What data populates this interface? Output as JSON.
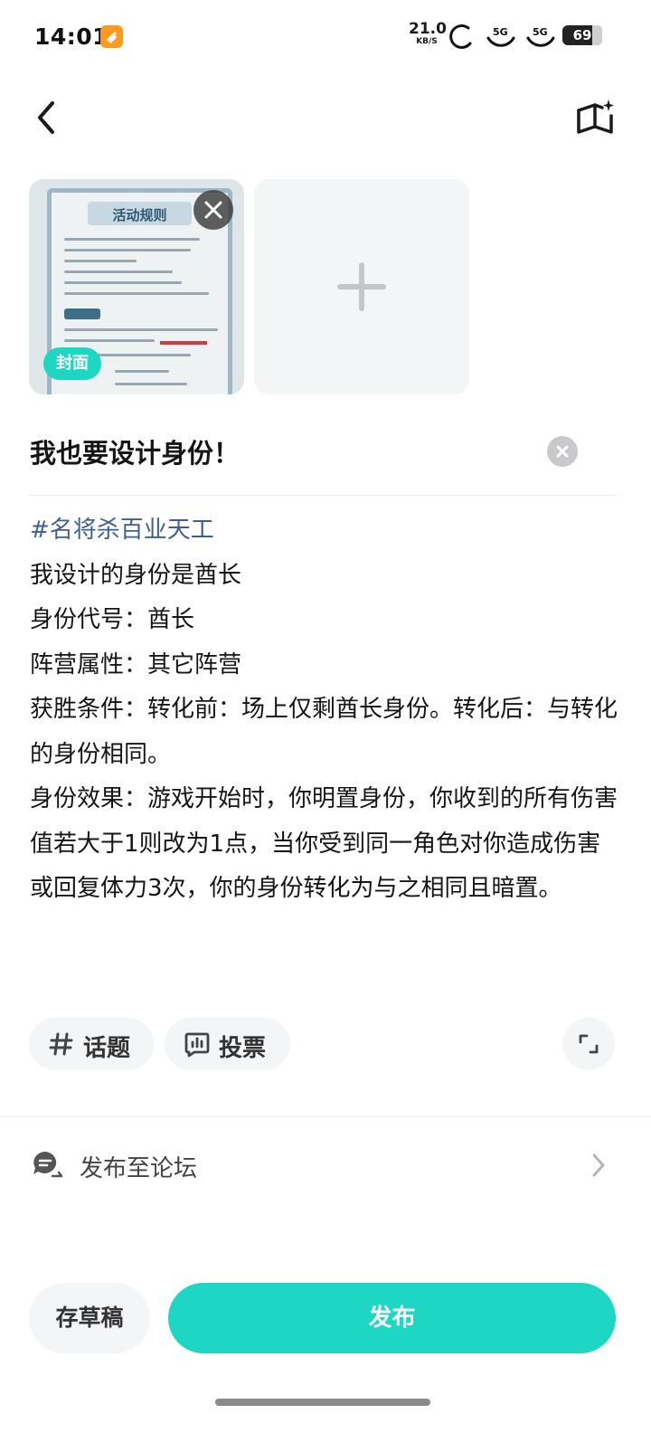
{
  "status_bar": {
    "time": "14:01",
    "net_speed_value": "21.0",
    "net_speed_unit": "KB/S",
    "battery_level": "69",
    "signal_1": "5G",
    "signal_2": "5G",
    "icons": [
      "app-notification-icon",
      "hotspot-icon",
      "signal-5g-icon",
      "signal-5g-icon",
      "battery-icon"
    ]
  },
  "header": {
    "back_icon": "chevron-left-icon",
    "guide_icon": "book-sparkle-icon"
  },
  "images": {
    "thumb_title": "活动规则",
    "cover_badge": "封面",
    "remove_icon": "close-icon",
    "add_icon": "plus-icon"
  },
  "post": {
    "title": "我也要设计身份！",
    "clear_icon": "clear-circle-icon",
    "hashtag": "#名将杀百业天工",
    "lines": [
      "我设计的身份是酋长",
      "身份代号：酋长",
      "阵营属性：其它阵营",
      "获胜条件：转化前：场上仅剩酋长身份。转化后：与转化的身份相同。",
      "身份效果：游戏开始时，你明置身份，你收到的所有伤害值若大于1则改为1点，当你受到同一角色对你造成伤害或回复体力3次，你的身份转化为与之相同且暗置。"
    ]
  },
  "toolbar": {
    "topic_label": "话题",
    "vote_label": "投票",
    "expand_icon": "expand-icon"
  },
  "forum": {
    "label": "发布至论坛",
    "icon": "chat-bubble-icon",
    "chevron": "chevron-right-icon"
  },
  "actions": {
    "draft_label": "存草稿",
    "publish_label": "发布"
  },
  "colors": {
    "accent": "#1dd6c3",
    "hashtag": "#3f5f93"
  }
}
